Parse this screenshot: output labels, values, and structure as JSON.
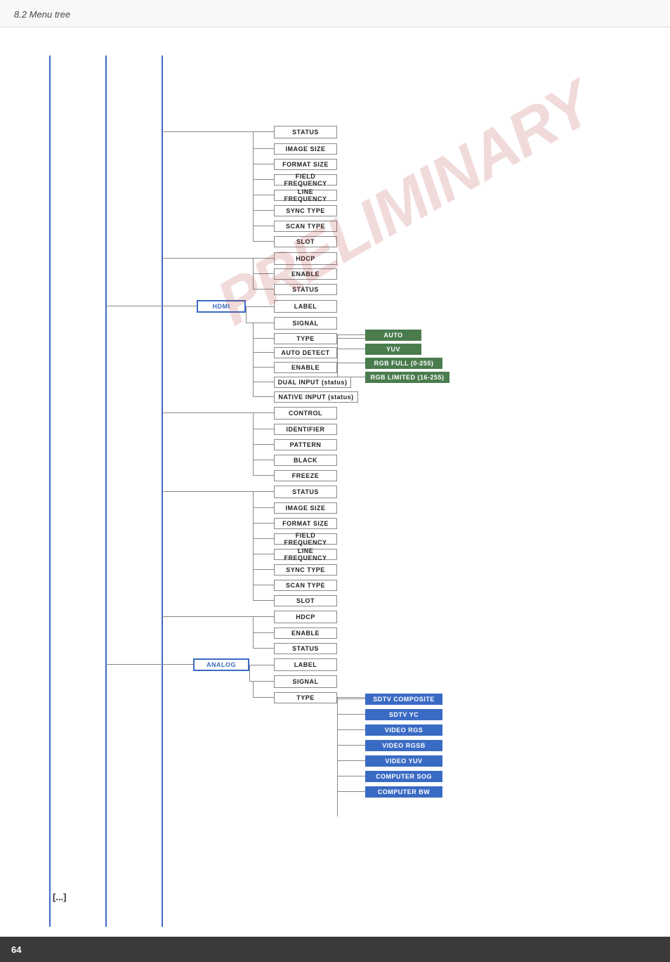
{
  "header": {
    "title": "8.2 Menu tree"
  },
  "footer": {
    "page_number": "64"
  },
  "watermark": "PRELIMINARY",
  "ellipsis": "[...]",
  "tree": {
    "hdmi_label": "HDMI",
    "analog_label": "ANALOG",
    "nodes": {
      "status_top": "STATUS",
      "image_size_top": "IMAGE SIZE",
      "format_size_top": "FORMAT SIZE",
      "field_frequency_top": "FIELD FREQUENCY",
      "line_frequency_top": "LINE FREQUENCY",
      "sync_type_top": "SYNC TYPE",
      "scan_type_top": "SCAN TYPE",
      "slot_top": "SLOT",
      "hdcp_top": "HDCP",
      "enable_top": "ENABLE",
      "status2_top": "STATUS",
      "label_hdmi": "LABEL",
      "signal_hdmi": "SIGNAL",
      "type_hdmi": "TYPE",
      "auto_detect": "AUTO DETECT",
      "enable_hdmi": "ENABLE",
      "dual_input": "DUAL INPUT (status)",
      "native_input": "NATIVE INPUT (status)",
      "control": "CONTROL",
      "identifier": "IDENTIFIER",
      "pattern": "PATTERN",
      "black": "BLACK",
      "freeze": "FREEZE",
      "status_mid": "STATUS",
      "image_size_mid": "IMAGE SIZE",
      "format_size_mid": "FORMAT SIZE",
      "field_frequency_mid": "FIELD FREQUENCY",
      "line_frequency_mid": "LINE FREQUENCY",
      "sync_type_mid": "SYNC TYPE",
      "scan_type_mid": "SCAN TYPE",
      "slot_mid": "SLOT",
      "hdcp_mid": "HDCP",
      "enable_mid": "ENABLE",
      "status3_mid": "STATUS",
      "label_analog": "LABEL",
      "signal_analog": "SIGNAL",
      "type_analog": "TYPE",
      "auto_option": "AUTO",
      "yuv_option": "YUV",
      "rgb_full_option": "RGB FULL (0-255)",
      "rgb_limited_option": "RGB LIMITED (16-255)",
      "sdtv_composite": "SDTV COMPOSITE",
      "sdtv_yc": "SDTV YC",
      "video_rgs": "VIDEO RGS",
      "video_rgsb": "VIDEO RGSB",
      "video_yuv": "VIDEO YUV",
      "computer_sog": "COMPUTER SOG",
      "computer_bw": "COMPUTER BW"
    }
  }
}
